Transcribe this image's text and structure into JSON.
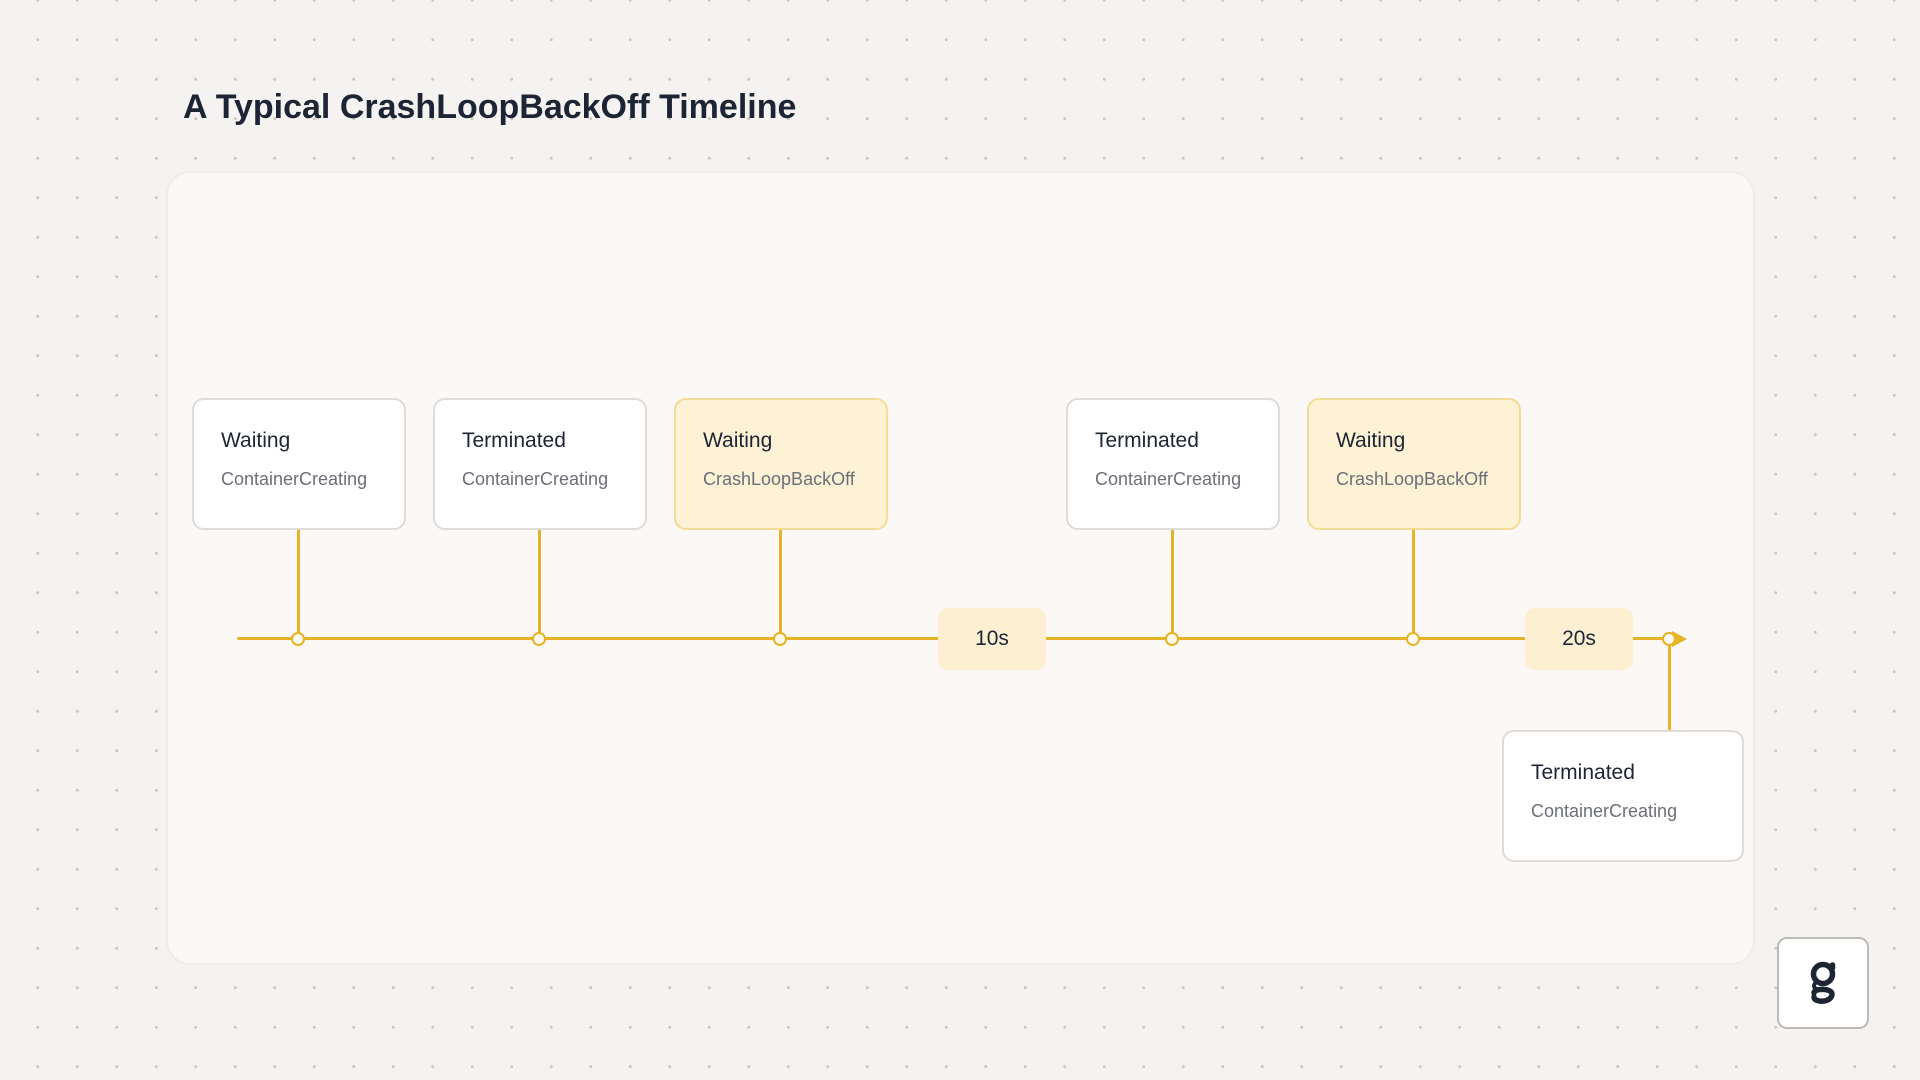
{
  "title": "A Typical CrashLoopBackOff Timeline",
  "colors": {
    "accent": "#e6b326",
    "highlight_fill": "#fef2d6",
    "highlight_border": "#f5dc96",
    "card_fill": "#ffffff",
    "time_label_fill": "#fdf0d2"
  },
  "events": [
    {
      "state": "Waiting",
      "reason": "ContainerCreating",
      "highlight": false,
      "position": "above"
    },
    {
      "state": "Terminated",
      "reason": "ContainerCreating",
      "highlight": false,
      "position": "above"
    },
    {
      "state": "Waiting",
      "reason": "CrashLoopBackOff",
      "highlight": true,
      "position": "above"
    },
    {
      "state": "Terminated",
      "reason": "ContainerCreating",
      "highlight": false,
      "position": "above"
    },
    {
      "state": "Waiting",
      "reason": "CrashLoopBackOff",
      "highlight": true,
      "position": "above"
    },
    {
      "state": "Terminated",
      "reason": "ContainerCreating",
      "highlight": false,
      "position": "below"
    }
  ],
  "time_labels": [
    "10s",
    "20s"
  ],
  "logo": {
    "icon": "logo-g-icon",
    "letter": "g"
  }
}
